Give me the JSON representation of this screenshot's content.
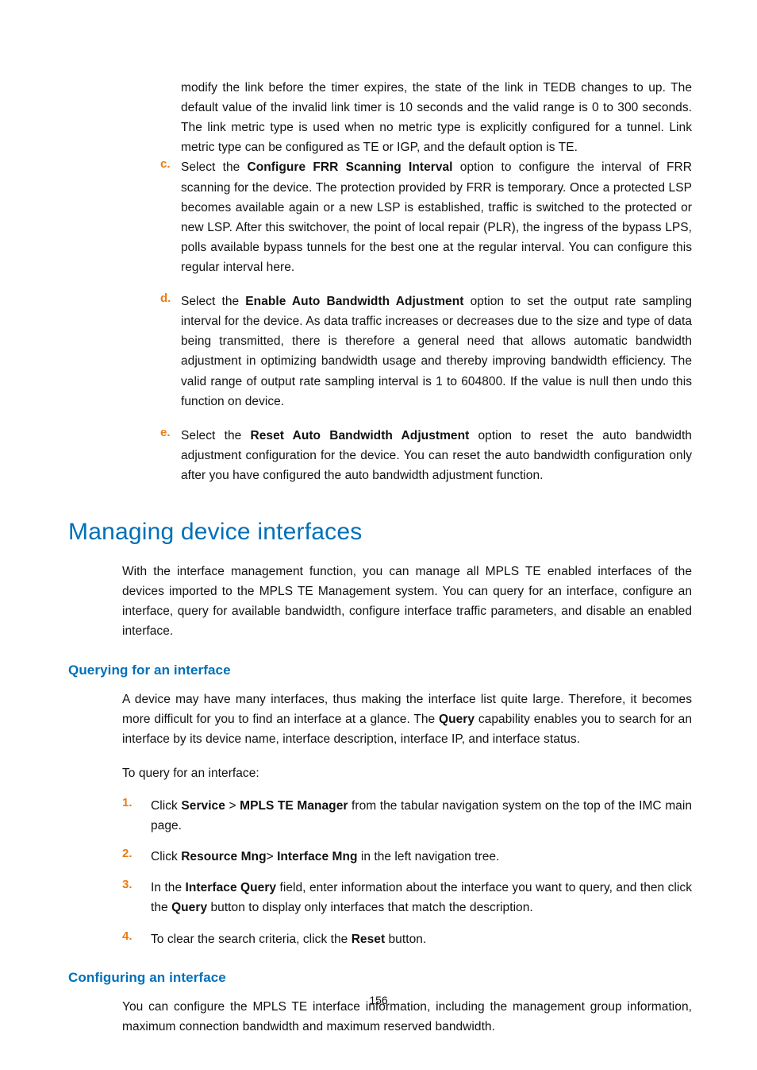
{
  "top_paragraph": "modify the link before the timer expires, the state of the link in TEDB changes to up. The default value of the invalid link timer is 10 seconds and the valid range is 0 to 300 seconds. The link metric type is used when no metric type is explicitly configured for a tunnel. Link metric type can be configured as TE or IGP, and the default option is TE.",
  "alpha": [
    {
      "marker": "c.",
      "pre": "Select the ",
      "bold": "Configure FRR Scanning Interval",
      "post": " option to configure the interval of FRR scanning for the device. The protection provided by FRR is temporary. Once a protected LSP becomes available again or a new LSP is established, traffic is switched to the protected or new LSP. After this switchover, the point of local repair (PLR), the ingress of the bypass LPS, polls available bypass tunnels for the best one at the regular interval. You can configure this regular interval here."
    },
    {
      "marker": "d.",
      "pre": "Select the ",
      "bold": "Enable Auto Bandwidth Adjustment",
      "post": " option to set the output rate sampling interval for the device. As data traffic increases or decreases due to the size and type of data being transmitted, there is therefore a general need that allows automatic bandwidth adjustment in optimizing bandwidth usage and thereby improving bandwidth efficiency. The valid range of output rate sampling interval is 1 to 604800. If the value is null then undo this function on device."
    },
    {
      "marker": "e.",
      "pre": "Select the ",
      "bold": "Reset Auto Bandwidth Adjustment",
      "post": " option to reset the auto bandwidth adjustment configuration for the device. You can reset the auto bandwidth configuration only after you have configured the auto bandwidth adjustment function."
    }
  ],
  "h1": "Managing device interfaces",
  "intro": "With the interface management function, you can manage all MPLS TE enabled interfaces of the devices imported to the MPLS TE Management system. You can query for an interface, configure an interface, query for available bandwidth, configure interface traffic parameters, and disable an enabled interface.",
  "q": {
    "heading": "Querying for an interface",
    "p1_pre": "A device may have many interfaces, thus making the interface list quite large. Therefore, it becomes more difficult for you to find an interface at a glance. The ",
    "p1_bold": "Query",
    "p1_post": " capability enables you to search for an interface by its device name, interface description, interface IP, and interface status.",
    "p2": "To query for an interface:",
    "steps": {
      "s1": {
        "marker": "1.",
        "pre": "Click ",
        "b1": "Service",
        "mid": " > ",
        "b2": "MPLS TE Manager",
        "post": " from the tabular navigation system on the top of the IMC main page."
      },
      "s2": {
        "marker": "2.",
        "pre": "Click ",
        "b1": "Resource Mng",
        "mid": "> ",
        "b2": "Interface Mng",
        "post": " in the left navigation tree."
      },
      "s3": {
        "marker": "3.",
        "pre": "In the ",
        "b1": "Interface Query",
        "mid": " field, enter information about the interface you want to query, and then click the ",
        "b2": "Query",
        "post": " button to display only interfaces that match the description."
      },
      "s4": {
        "marker": "4.",
        "pre": "To clear the search criteria, click the ",
        "b1": "Reset",
        "post": " button."
      }
    }
  },
  "c": {
    "heading": "Configuring an interface",
    "p1": "You can configure the MPLS TE interface information, including the management group information, maximum connection bandwidth and maximum reserved bandwidth."
  },
  "page_number": "156"
}
